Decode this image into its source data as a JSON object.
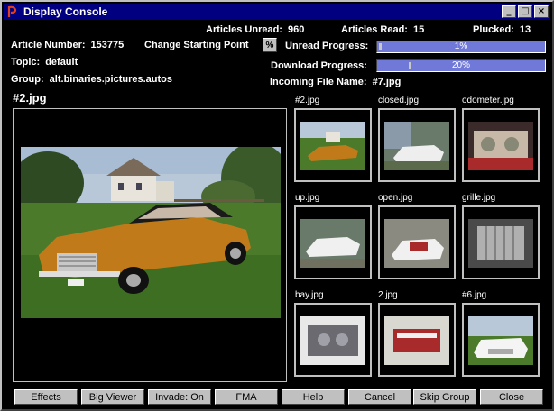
{
  "window": {
    "title": "Display Console",
    "controls": {
      "minimize": "_",
      "maximize": "□",
      "close": "×"
    }
  },
  "stats": {
    "articles_unread_label": "Articles Unread:",
    "articles_unread": "960",
    "articles_read_label": "Articles Read:",
    "articles_read": "15",
    "plucked_label": "Plucked:",
    "plucked": "13"
  },
  "article": {
    "number_label": "Article Number:",
    "number": "153775",
    "topic_label": "Topic:",
    "topic": "default",
    "group_label": "Group:",
    "group": "alt.binaries.pictures.autos"
  },
  "controls": {
    "change_start_label": "Change Starting Point",
    "pct_button": "%",
    "unread_progress_label": "Unread Progress:",
    "unread_progress_text": "1%",
    "unread_progress_fraction": 0.01,
    "download_progress_label": "Download Progress:",
    "download_progress_text": "20%",
    "download_progress_fraction": 0.2,
    "incoming_label": "Incoming File Name:",
    "incoming_file": "#7.jpg"
  },
  "main_image": {
    "name": "#2.jpg"
  },
  "thumbnails": [
    {
      "name": "#2.jpg"
    },
    {
      "name": "closed.jpg"
    },
    {
      "name": "odometer.jpg"
    },
    {
      "name": "up.jpg"
    },
    {
      "name": "open.jpg"
    },
    {
      "name": "grille.jpg"
    },
    {
      "name": "bay.jpg"
    },
    {
      "name": "2.jpg"
    },
    {
      "name": "#6.jpg"
    }
  ],
  "buttons": {
    "effects": "Effects",
    "big_viewer": "Big Viewer",
    "invade": "Invade: On",
    "fma": "FMA",
    "help": "Help",
    "cancel": "Cancel",
    "skip_group": "Skip Group",
    "close": "Close"
  }
}
